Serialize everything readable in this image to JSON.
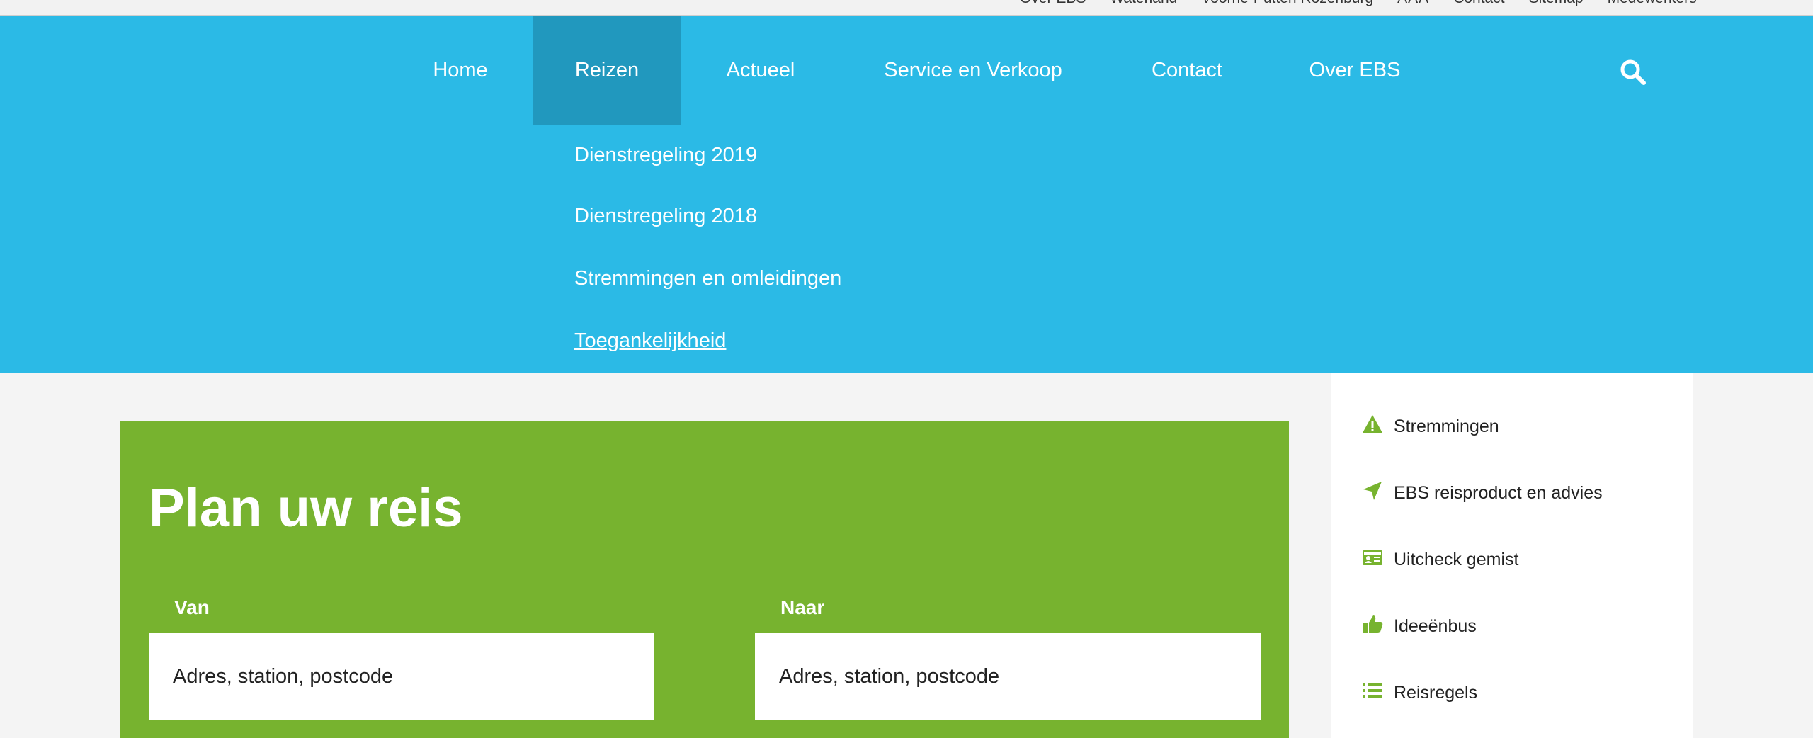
{
  "utility": {
    "links": [
      "Over EBS",
      "Waterland",
      "Voorne-Putten Rozenburg",
      "Contact",
      "Sitemap",
      "Medewerkers"
    ],
    "font_size_label": "AAA"
  },
  "nav": {
    "items": [
      {
        "label": "Home"
      },
      {
        "label": "Reizen",
        "active": true
      },
      {
        "label": "Actueel"
      },
      {
        "label": "Service en Verkoop"
      },
      {
        "label": "Contact"
      },
      {
        "label": "Over EBS"
      }
    ],
    "search_icon": "search-icon",
    "submenu": [
      {
        "label": "Dienstregeling 2019"
      },
      {
        "label": "Dienstregeling 2018"
      },
      {
        "label": "Stremmingen en omleidingen"
      },
      {
        "label": "Toegankelijkheid"
      }
    ]
  },
  "plan": {
    "title": "Plan uw reis",
    "from_label": "Van",
    "from_placeholder": "Adres, station, postcode",
    "to_label": "Naar",
    "to_placeholder": "Adres, station, postcode"
  },
  "sidebar": {
    "links": [
      {
        "label": "Stremmingen",
        "icon": "warning-icon"
      },
      {
        "label": "EBS reisproduct en advies",
        "icon": "location-arrow-icon"
      },
      {
        "label": "Uitcheck gemist",
        "icon": "id-card-icon"
      },
      {
        "label": "Ideeënbus",
        "icon": "thumbs-up-icon"
      },
      {
        "label": "Reisregels",
        "icon": "list-icon"
      }
    ]
  },
  "colors": {
    "nav_blue": "#2bbae6",
    "nav_active": "#2198be",
    "plan_green": "#77b32f",
    "icon_green": "#77b32f",
    "background": "#f4f4f4"
  }
}
